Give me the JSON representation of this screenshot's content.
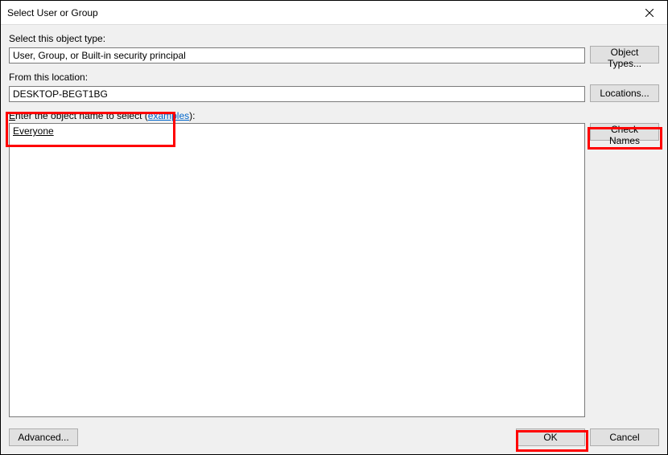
{
  "titlebar": {
    "title": "Select User or Group"
  },
  "objectType": {
    "label": "Select this object type:",
    "value": "User, Group, or Built-in security principal",
    "button": "Object Types..."
  },
  "location": {
    "label": "From this location:",
    "value": "DESKTOP-BEGT1BG",
    "button": "Locations..."
  },
  "objectName": {
    "label_prefix_underlined": "E",
    "label_rest": "nter the object name to select (",
    "examples_link": "examples",
    "label_suffix": "):",
    "value": "Everyone",
    "check_button": "Check Names"
  },
  "footer": {
    "advanced": "Advanced...",
    "ok": "OK",
    "cancel": "Cancel"
  }
}
